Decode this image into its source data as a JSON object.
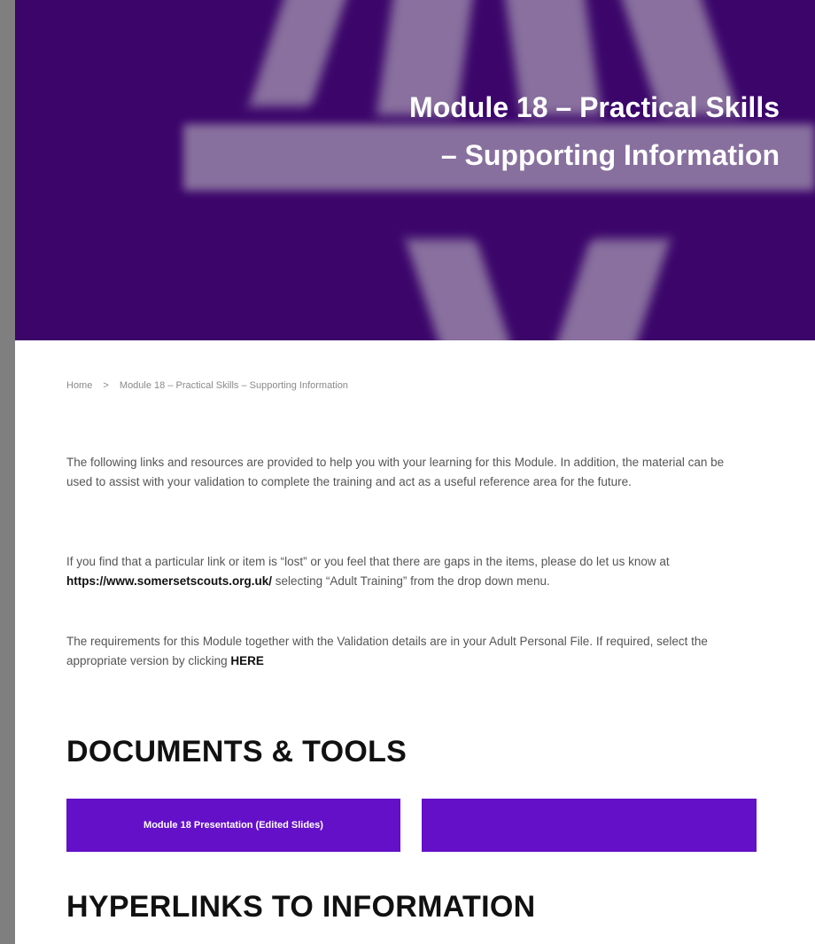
{
  "hero": {
    "title_line1": "Module 18 – Practical Skills",
    "title_line2": "– Supporting Information"
  },
  "breadcrumb": {
    "home": "Home",
    "separator": ">",
    "current": "Module 18 – Practical Skills – Supporting Information"
  },
  "intro": {
    "p1": "The following links and resources are provided to help you with your learning for this Module. In addition, the material can be used to assist with your validation to complete the training and act as a useful reference area for the future.",
    "p2_a": "If you find that a particular link or item is “lost” or you feel that there are gaps in the items, please do let us know at ",
    "p2_link": "https://www.somersetscouts.org.uk/",
    "p2_b": " selecting “Adult Training” from the drop down menu.",
    "p3_a": "The requirements for this Module together with the Validation details are in your Adult Personal File. If required, select the appropriate version by clicking ",
    "p3_link": "HERE"
  },
  "documents": {
    "title": "DOCUMENTS & TOOLS",
    "button1": "Module 18 Presentation (Edited Slides)",
    "button2": ""
  },
  "hyperlinks": {
    "title": "HYPERLINKS TO INFORMATION"
  },
  "colors": {
    "hero_bg": "#3b056a",
    "button_bg": "#6410c9"
  }
}
